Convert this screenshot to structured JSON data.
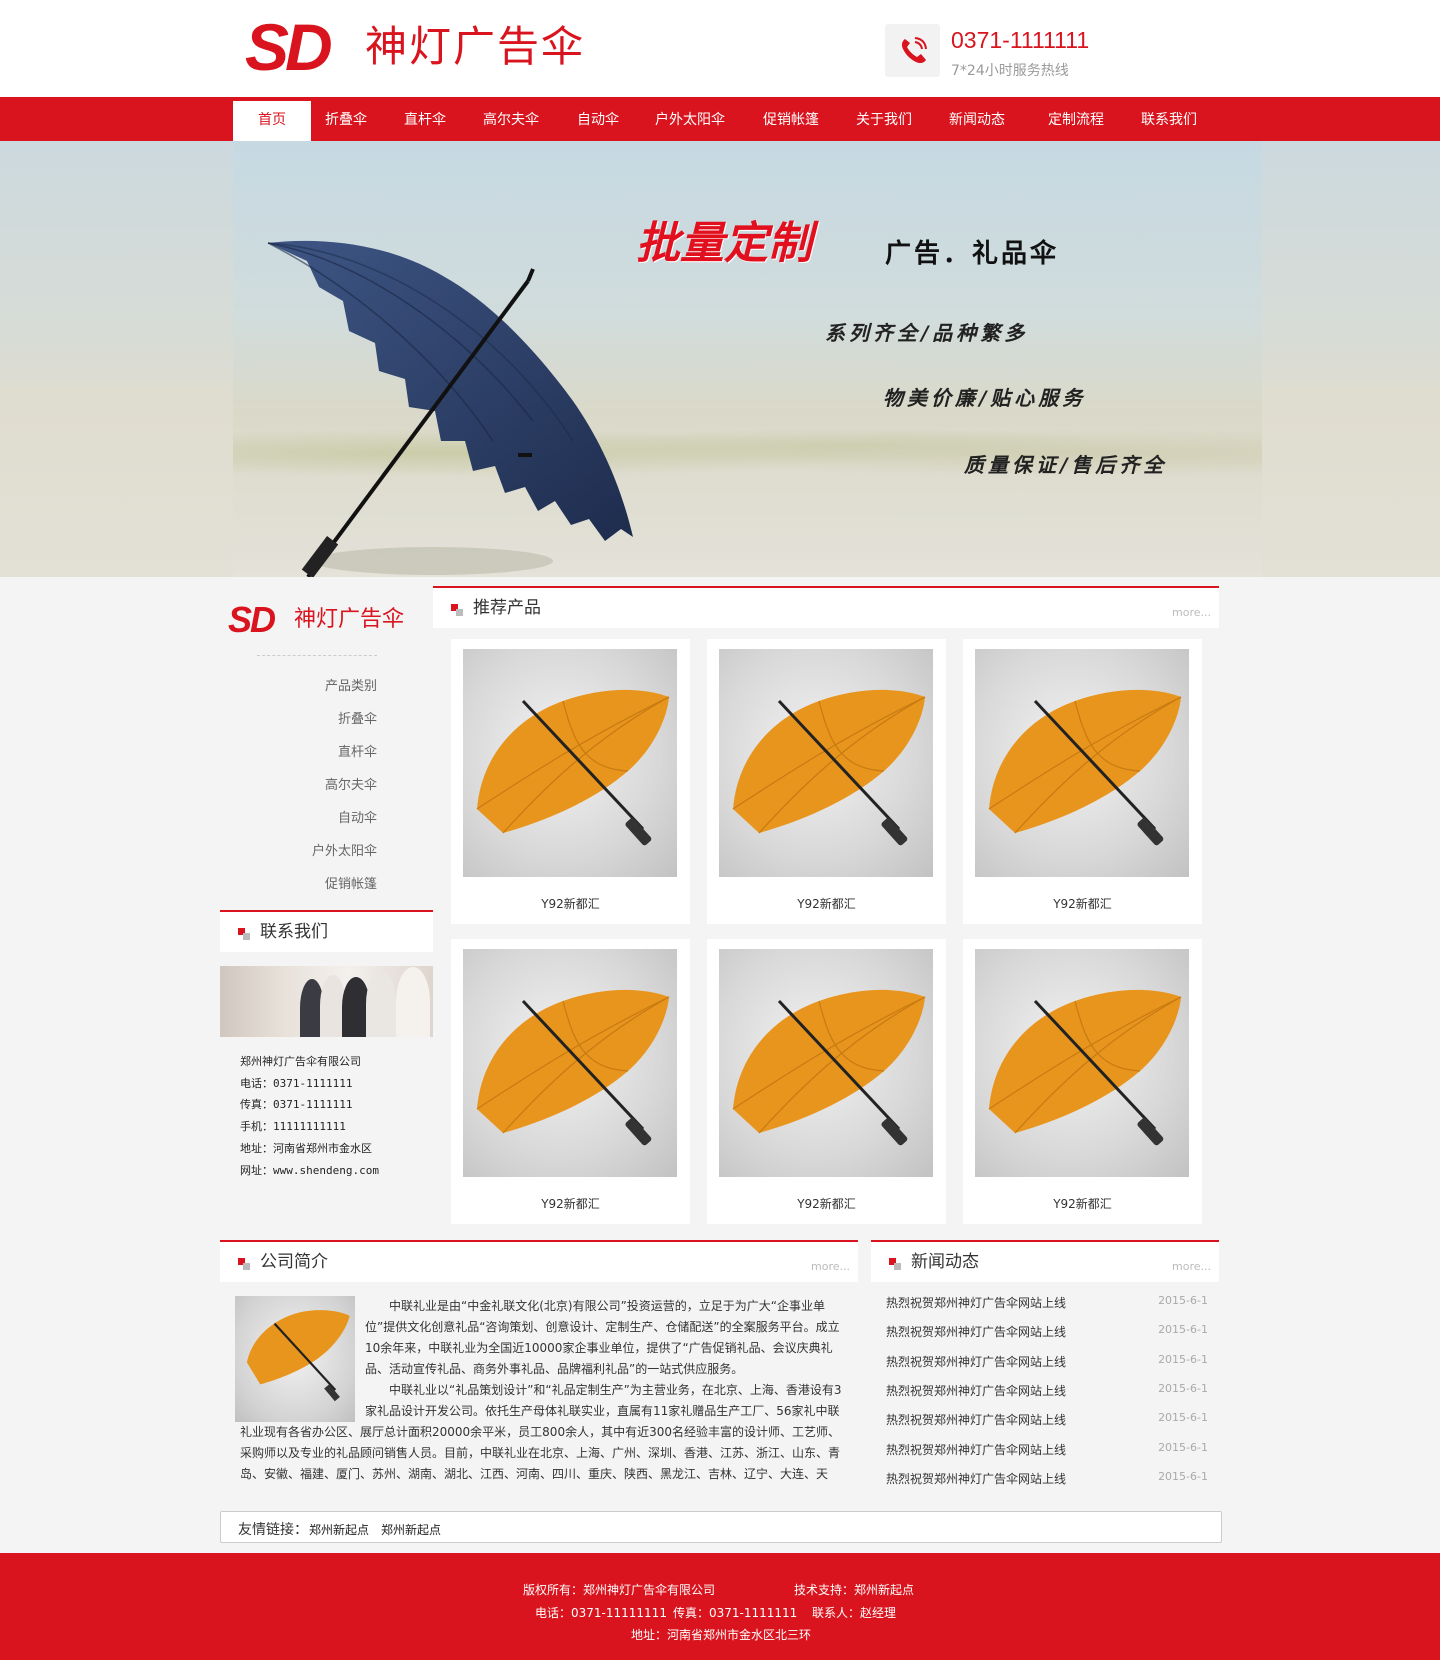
{
  "header": {
    "logo_mark": "SD",
    "logo_text": "神灯广告伞",
    "phone": "0371-1111111",
    "phone_sub": "7*24小时服务热线"
  },
  "nav": {
    "items": [
      "首页",
      "折叠伞",
      "直杆伞",
      "高尔夫伞",
      "自动伞",
      "户外太阳伞",
      "促销帐篷",
      "关于我们",
      "新闻动态",
      "定制流程",
      "联系我们"
    ],
    "active_index": 0
  },
  "banner": {
    "title": "批量定制",
    "subtitle": "广告．礼品伞",
    "lines": [
      "系列齐全/品种繁多",
      "物美价廉/贴心服务",
      "质量保证/售后齐全"
    ]
  },
  "sidebar": {
    "logo_mark": "SD",
    "logo_text": "神灯广告伞",
    "categories": [
      "产品类别",
      "折叠伞",
      "直杆伞",
      "高尔夫伞",
      "自动伞",
      "户外太阳伞",
      "促销帐篷"
    ],
    "contact_title": "联系我们",
    "contact": {
      "company": "郑州神灯广告伞有限公司",
      "tel": "电话：0371-1111111",
      "fax": "传真：0371-1111111",
      "mobile": "手机：11111111111",
      "address": "地址：河南省郑州市金水区",
      "website": "网址：www.shendeng.com"
    }
  },
  "products": {
    "title": "推荐产品",
    "more": "more...",
    "items": [
      "Y92新都汇",
      "Y92新都汇",
      "Y92新都汇",
      "Y92新都汇",
      "Y92新都汇",
      "Y92新都汇"
    ]
  },
  "about": {
    "title": "公司简介",
    "more": "more...",
    "paragraphs": [
      "中联礼业是由“中金礼联文化(北京)有限公司”投资运营的，立足于为广大“企事业单位”提供文化创意礼品“咨询策划、创意设计、定制生产、仓储配送”的全案服务平台。成立10余年来，中联礼业为全国近10000家企事业单位，提供了“广告促销礼品、会议庆典礼品、活动宣传礼品、商务外事礼品、品牌福利礼品”的一站式供应服务。",
      "中联礼业以“礼品策划设计”和“礼品定制生产”为主营业务，在北京、上海、香港设有3家礼品设计开发公司。依托生产母体礼联实业，直属有11家礼赠品生产工厂、56家礼中联礼业现有各省办公区、展厅总计面积20000余平米，员工800余人，其中有近300名经验丰富的设计师、工艺师、采购师以及专业的礼品顾问销售人员。目前，中联礼业在北京、上海、广州、深圳、香港、江苏、浙江、山东、青岛、安徽、福建、厦门、苏州、湖南、湖北、江西、河南、四川、重庆、陕西、黑龙江、吉林、辽宁、大连、天"
    ]
  },
  "news": {
    "title": "新闻动态",
    "more": "more...",
    "items": [
      {
        "title": "热烈祝贺郑州神灯广告伞网站上线",
        "date": "2015-6-1"
      },
      {
        "title": "热烈祝贺郑州神灯广告伞网站上线",
        "date": "2015-6-1"
      },
      {
        "title": "热烈祝贺郑州神灯广告伞网站上线",
        "date": "2015-6-1"
      },
      {
        "title": "热烈祝贺郑州神灯广告伞网站上线",
        "date": "2015-6-1"
      },
      {
        "title": "热烈祝贺郑州神灯广告伞网站上线",
        "date": "2015-6-1"
      },
      {
        "title": "热烈祝贺郑州神灯广告伞网站上线",
        "date": "2015-6-1"
      },
      {
        "title": "热烈祝贺郑州神灯广告伞网站上线",
        "date": "2015-6-1"
      }
    ]
  },
  "friends": {
    "label": "友情链接：",
    "links": [
      "郑州新起点",
      "郑州新起点"
    ]
  },
  "footer": {
    "copyright": "版权所有：郑州神灯广告伞有限公司",
    "support": "技术支持：郑州新起点",
    "tel": "电话：0371-11111111",
    "fax": "传真：0371-1111111",
    "contact": "联系人：赵经理",
    "address": "地址：河南省郑州市金水区北三环"
  },
  "colors": {
    "brand_red": "#d9141e",
    "umbrella_orange": "#e8951e",
    "umbrella_navy": "#2b3f66"
  },
  "icons": [
    "phone-icon",
    "section-marker-icon"
  ]
}
